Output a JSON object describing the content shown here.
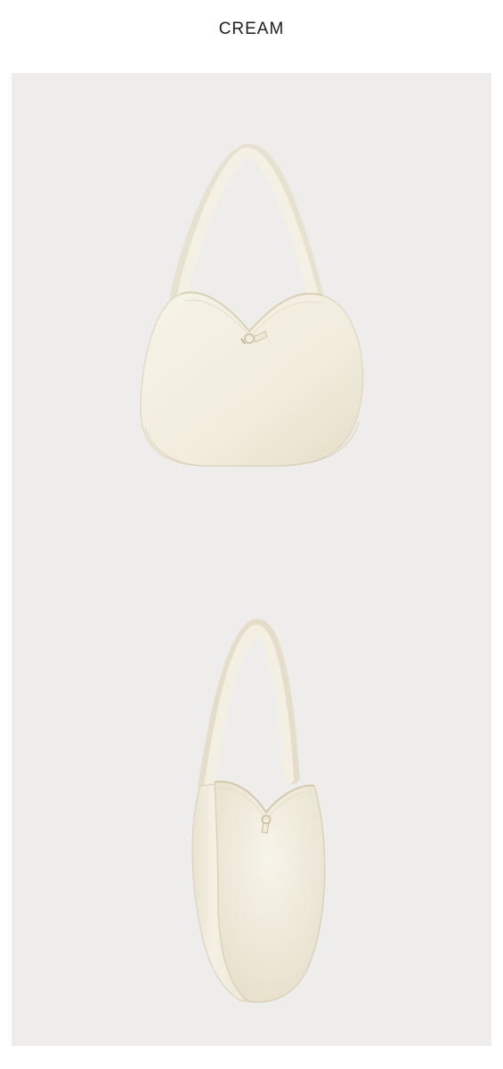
{
  "header": {
    "color_name": "CREAM"
  },
  "gallery": {
    "background_color": "#eeedeb",
    "product_color": "#f3efe1",
    "images": [
      {
        "view": "front",
        "icon": "shoulder-bag-front-view"
      },
      {
        "view": "side",
        "icon": "shoulder-bag-side-view"
      }
    ]
  }
}
